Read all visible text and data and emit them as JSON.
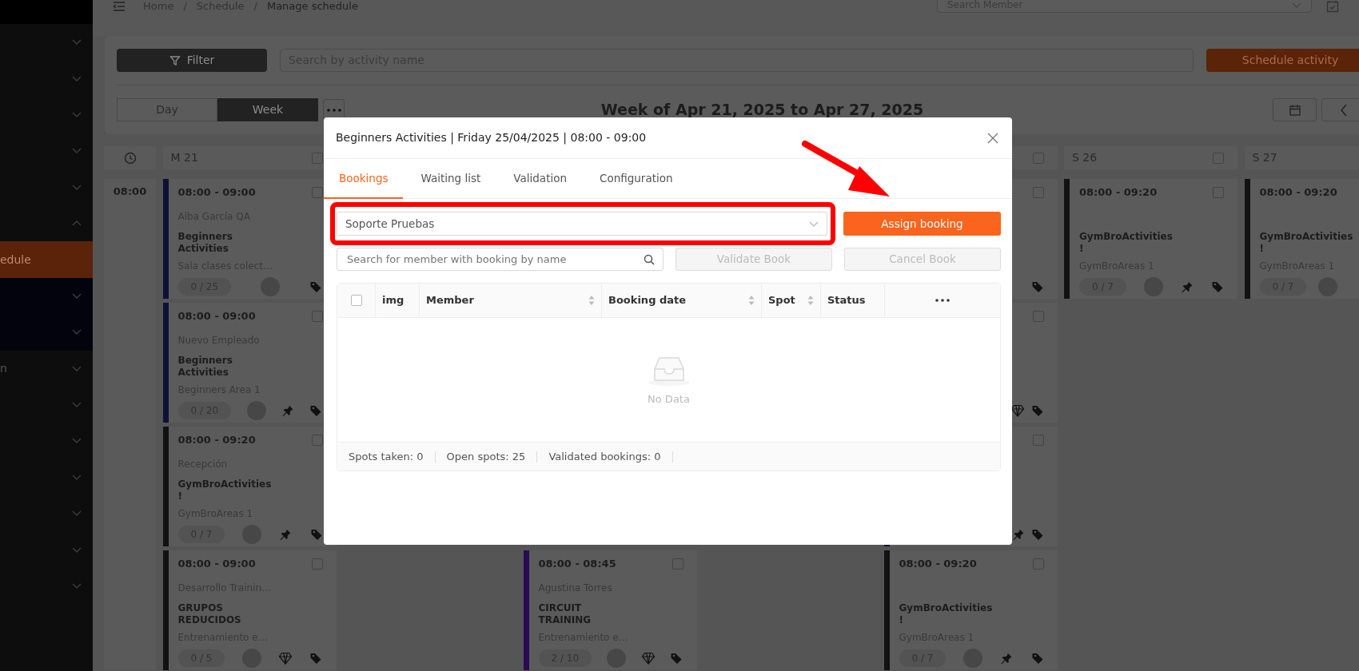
{
  "sidebar": {
    "items": [
      {
        "selected": false,
        "expanded": false
      },
      {
        "selected": false,
        "expanded": false
      },
      {
        "selected": false,
        "expanded": false
      },
      {
        "selected": false,
        "expanded": false
      },
      {
        "selected": false,
        "expanded": false
      },
      {
        "selected": false,
        "expanded": true,
        "children": [
          {
            "label": "edule",
            "selected": true
          },
          {
            "selected": false,
            "expanded": false
          },
          {
            "selected": false,
            "expanded": false
          }
        ]
      },
      {
        "label": "n",
        "selected": false,
        "expanded": false
      },
      {
        "selected": false,
        "expanded": false
      },
      {
        "selected": false,
        "expanded": false
      },
      {
        "selected": false,
        "expanded": false
      },
      {
        "selected": false,
        "expanded": false
      },
      {
        "selected": false,
        "expanded": false
      },
      {
        "selected": false,
        "expanded": false
      }
    ]
  },
  "header": {
    "breadcrumbs": [
      {
        "kind": "link",
        "label": "Home"
      },
      {
        "kind": "separator",
        "label": "/"
      },
      {
        "kind": "link",
        "label": "Schedule"
      },
      {
        "kind": "separator",
        "label": "/"
      },
      {
        "kind": "current",
        "label": "Manage schedule"
      }
    ],
    "member_search": {
      "placeholder": "Search Member"
    }
  },
  "toolbar": {
    "filter_button": "Filter",
    "search": {
      "placeholder": "Search by activity name"
    },
    "schedule_button": "Schedule activity",
    "views": [
      {
        "label": "Day",
        "selected": false
      },
      {
        "label": "Week",
        "selected": true
      }
    ],
    "week_title": "Week of Apr 21, 2025 to Apr 27, 2025"
  },
  "calendar": {
    "time_slots": [
      "08:00"
    ],
    "days": [
      {
        "label": "M 21",
        "checked": false,
        "kind": "open",
        "cards": [
          {
            "time": "08:00 - 09:00",
            "name": "Alba García QA",
            "activity": "Beginners Activities",
            "area": "Sala clases colect…",
            "count": "0 / 25",
            "avatar": true,
            "checked": false,
            "color": "#0e1137",
            "tag": true
          },
          {
            "time": "08:00 - 09:00",
            "name": "Nuevo Empleado",
            "activity": "Beginners Activities",
            "area": "Beginners Area 1",
            "count": "0 / 20",
            "avatar": true,
            "checked": false,
            "color": "#0e1137",
            "pin": true,
            "tag": true
          },
          {
            "time": "08:00 - 09:20",
            "name": "Recepción",
            "activity": "GymBroActivities !",
            "area": "GymBroAreas 1",
            "count": "0 / 7",
            "avatar": true,
            "checked": false,
            "color": "#121212",
            "pin": true,
            "tag": true
          },
          {
            "time": "08:00 - 09:00",
            "name": "Desarrollo Trainin…",
            "activity": "GRUPOS REDUCIDOS",
            "area": "Entrenamiento e…",
            "count": "0 / 5",
            "avatar": true,
            "checked": false,
            "color": "#121212",
            "diamond": true,
            "tag": true
          }
        ]
      },
      {
        "kind": "covered"
      },
      {
        "kind": "covered",
        "cards": [
          {
            "time": "08:00 - 08:45",
            "name": "Agustina Torres",
            "activity": "CIRCUIT TRAINING",
            "area": "Entrenamiento e…",
            "count": "2 / 10",
            "avatar": true,
            "checked": false,
            "color": "#2a0a55",
            "diamond": true,
            "tag": true
          }
        ]
      },
      {
        "kind": "covered"
      },
      {
        "checked": false,
        "kind": "open",
        "cards": [
          {
            "checked": false,
            "tag": true
          },
          {
            "checked": false,
            "diamond": true,
            "tag": true
          },
          {
            "checked": false,
            "color": "#0e1137",
            "pin": true,
            "tag": true
          },
          {
            "time": "08:00 - 09:20",
            "activity": "GymBroActivities !",
            "area": "GymBroAreas 1",
            "count": "0 / 7",
            "avatar": true,
            "checked": false,
            "color": "#121212",
            "pin": true,
            "tag": true
          }
        ]
      },
      {
        "label": "S 26",
        "checked": false,
        "kind": "open",
        "cards": [
          {
            "time": "08:00 - 09:20",
            "activity": "GymBroActivities !",
            "area": "GymBroAreas 1",
            "count": "0 / 7",
            "avatar": true,
            "checked": false,
            "color": "#121212",
            "pin": true,
            "tag": true
          }
        ]
      },
      {
        "label": "S 27",
        "kind": "open",
        "cards": [
          {
            "time": "08:00 - 09:20",
            "activity": "GymBroActivities !",
            "area": "GymBroAreas 1",
            "count": "0 / 7",
            "avatar": true,
            "color": "#121212"
          }
        ]
      }
    ]
  },
  "modal": {
    "title": "Beginners Activities | Friday 25/04/2025 | 08:00 - 09:00",
    "tabs": [
      {
        "label": "Bookings",
        "selected": true
      },
      {
        "label": "Waiting list",
        "selected": false
      },
      {
        "label": "Validation",
        "selected": false
      },
      {
        "label": "Configuration",
        "selected": false
      }
    ],
    "member_select": {
      "value": "Soporte Pruebas"
    },
    "assign_button": {
      "label": "Assign booking",
      "disabled": false
    },
    "search": {
      "placeholder": "Search for member with booking by name"
    },
    "actions": [
      {
        "label": "Validate Book",
        "disabled": true
      },
      {
        "label": "Cancel Book",
        "disabled": true
      }
    ],
    "table": {
      "select_all": {
        "checked": false
      },
      "columns": [
        {
          "label": "img",
          "sortable": false
        },
        {
          "label": "Member",
          "sortable": true
        },
        {
          "label": "Booking date",
          "sortable": true
        },
        {
          "label": "Spot",
          "sortable": true
        },
        {
          "label": "Status",
          "sortable": false
        }
      ],
      "empty_text": "No Data"
    },
    "footer": [
      "Spots taken: 0",
      "Open spots: 25",
      "Validated bookings: 0"
    ]
  }
}
